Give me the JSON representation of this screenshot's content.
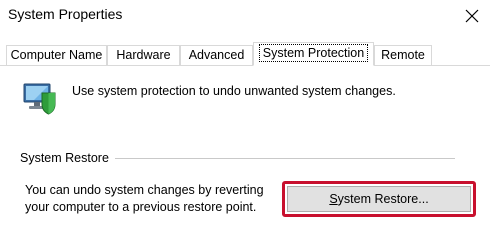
{
  "window": {
    "title": "System Properties",
    "close_icon": "close-icon"
  },
  "tabs": [
    {
      "label": "Computer Name",
      "active": false
    },
    {
      "label": "Hardware",
      "active": false
    },
    {
      "label": "Advanced",
      "active": false
    },
    {
      "label": "System Protection",
      "active": true
    },
    {
      "label": "Remote",
      "active": false
    }
  ],
  "panel": {
    "icon": "computer-shield-icon",
    "intro_text": "Use system protection to undo unwanted system changes.",
    "system_restore": {
      "group_label": "System Restore",
      "description_line1": "You can undo system changes by reverting",
      "description_line2": "your computer to a previous restore point.",
      "button": {
        "accel": "S",
        "label_rest": "ystem Restore...",
        "highlight_color": "#c8102e"
      }
    }
  }
}
